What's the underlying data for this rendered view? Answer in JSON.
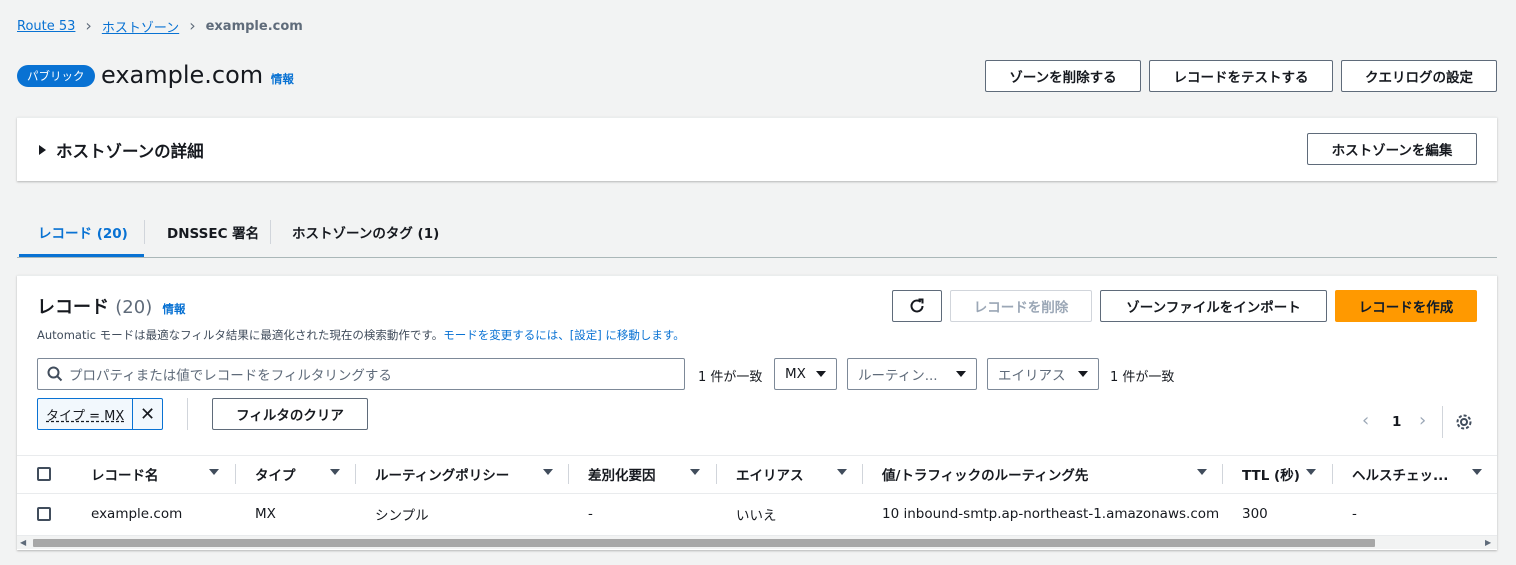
{
  "breadcrumb": {
    "items": [
      "Route 53",
      "ホストゾーン"
    ],
    "current": "example.com"
  },
  "header": {
    "badge": "パブリック",
    "title": "example.com",
    "info": "情報",
    "buttons": {
      "delete_zone": "ゾーンを削除する",
      "test_record": "レコードをテストする",
      "query_logging": "クエリログの設定"
    }
  },
  "details": {
    "title": "ホストゾーンの詳細",
    "edit_button": "ホストゾーンを編集"
  },
  "tabs": [
    {
      "label": "レコード (20)"
    },
    {
      "label": "DNSSEC 署名"
    },
    {
      "label": "ホストゾーンのタグ (1)"
    }
  ],
  "records": {
    "heading": "レコード",
    "count": "(20)",
    "info": "情報",
    "description": "Automatic モードは最適なフィルタ結果に最適化された現在の検索動作です。",
    "description_link": "モードを変更するには、[設定] に移動します。",
    "buttons": {
      "refresh_icon": "refresh-icon",
      "delete": "レコードを削除",
      "import": "ゾーンファイルをインポート",
      "create": "レコードを作成"
    },
    "search": {
      "placeholder": "プロパティまたは値でレコードをフィルタリングする",
      "match_count": "1 件が一致"
    },
    "filters": {
      "type": "MX",
      "routing": "ルーティン...",
      "alias": "エイリアス",
      "match_count": "1 件が一致"
    },
    "token": "タイプ = MX",
    "clear_filters": "フィルタのクリア",
    "pagination": {
      "page": "1"
    },
    "columns": [
      "レコード名",
      "タイプ",
      "ルーティングポリシー",
      "差別化要因",
      "エイリアス",
      "値/トラフィックのルーティング先",
      "TTL (秒)",
      "ヘルスチェッ..."
    ],
    "rows": [
      {
        "name": "example.com",
        "type": "MX",
        "routing": "シンプル",
        "diff": "-",
        "alias": "いいえ",
        "value": "10 inbound-smtp.ap-northeast-1.amazonaws.com",
        "ttl": "300",
        "health": "-"
      }
    ]
  }
}
